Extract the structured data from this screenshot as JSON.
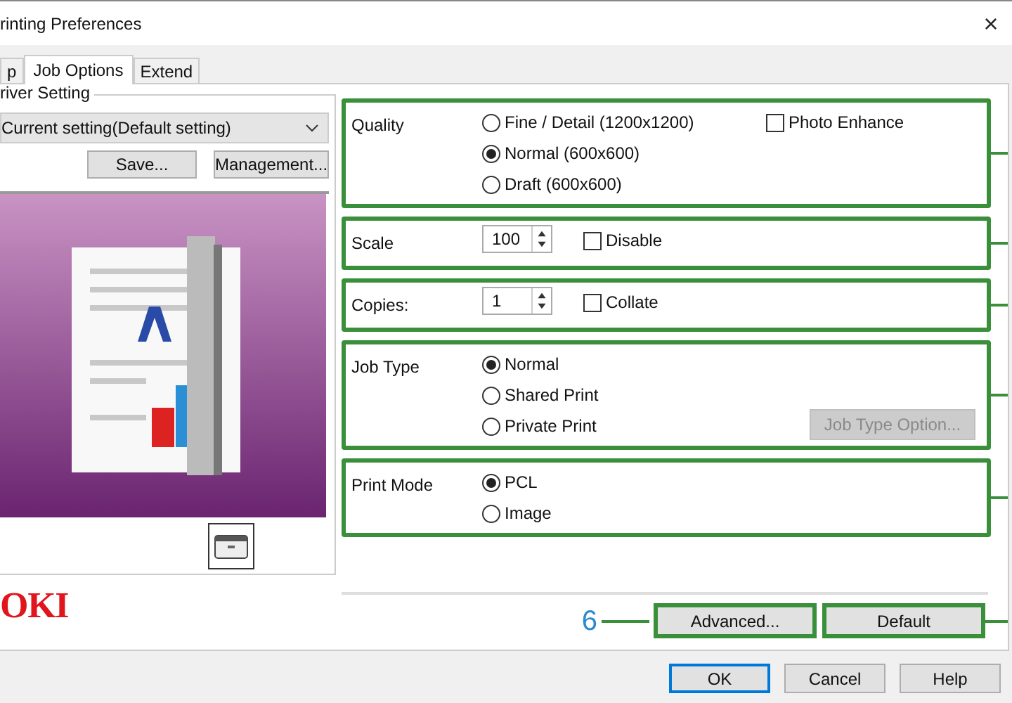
{
  "window": {
    "title": "rinting Preferences",
    "close": "×"
  },
  "tabs": [
    {
      "label": "p",
      "selected": false
    },
    {
      "label": "Job Options",
      "selected": true
    },
    {
      "label": "Extend",
      "selected": false
    }
  ],
  "driver_setting": {
    "label": "river Setting",
    "value": "Current setting(Default setting)",
    "buttons": [
      "Save...",
      "Management..."
    ]
  },
  "logo": "OKI",
  "groups": [
    {
      "label": "Quality",
      "annotated": true,
      "options": [
        {
          "label": "Fine / Detail (1200x1200)",
          "selected": false
        },
        {
          "label": "Normal (600x600)",
          "selected": true
        },
        {
          "label": "Draft (600x600)",
          "selected": false
        }
      ],
      "checkbox": {
        "label": "Photo Enhance",
        "checked": false
      }
    },
    {
      "label": "Scale",
      "annotated": true,
      "spin": "100",
      "checkbox": {
        "label": "Disable",
        "checked": false
      }
    },
    {
      "label": "Copies:",
      "annotated": true,
      "spin": "1",
      "checkbox": {
        "label": "Collate",
        "checked": false
      }
    },
    {
      "label": "Job Type",
      "annotated": true,
      "options": [
        {
          "label": "Normal",
          "selected": true
        },
        {
          "label": "Shared Print",
          "selected": false
        },
        {
          "label": "Private Print",
          "selected": false
        }
      ],
      "button": {
        "label": "Job Type Option...",
        "disabled": true
      }
    },
    {
      "label": "Print Mode",
      "annotated": true,
      "options": [
        {
          "label": "PCL",
          "selected": true
        },
        {
          "label": "Image",
          "selected": false
        }
      ]
    }
  ],
  "callout": "6",
  "bottom_buttons": [
    {
      "label": "Advanced...",
      "annotated": true
    },
    {
      "label": "Default",
      "annotated": true
    }
  ],
  "dialog_buttons": [
    {
      "label": "OK",
      "default": true
    },
    {
      "label": "Cancel",
      "default": false
    },
    {
      "label": "Help",
      "default": false
    }
  ]
}
